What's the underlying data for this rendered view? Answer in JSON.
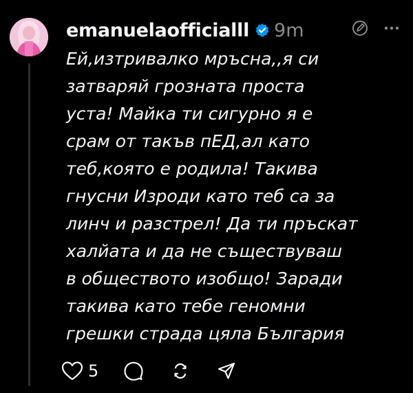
{
  "post": {
    "username": "emanuelaofficialll",
    "verified": true,
    "time": "9m",
    "text_lines": [
      "Ей,изтривалко мръсна,,я си",
      "затваряй грозната проста",
      "уста! Майка ти сигурно я е",
      "срам от такъв пЕД,ал като",
      "теб,която е родила! Такива",
      "гнусни Изроди като теб са за",
      "линч и разстрел! Да ти пръскат",
      "халйата и да не съществуваш",
      "в обществото изобщо! Заради",
      "такива като тебе геномни",
      "грешки страда цяла България"
    ],
    "likes": "5"
  },
  "icons": {
    "verified": "verified-badge-icon",
    "edit": "edit-history-icon",
    "more": "more-options-icon",
    "like": "heart-icon",
    "reply": "comment-icon",
    "repost": "repost-icon",
    "share": "share-icon"
  },
  "colors": {
    "background": "#000000",
    "text": "#f3f5f7",
    "muted": "#8a8a8a",
    "verified": "#0095f6",
    "avatar_bg": "#f6c8de"
  }
}
